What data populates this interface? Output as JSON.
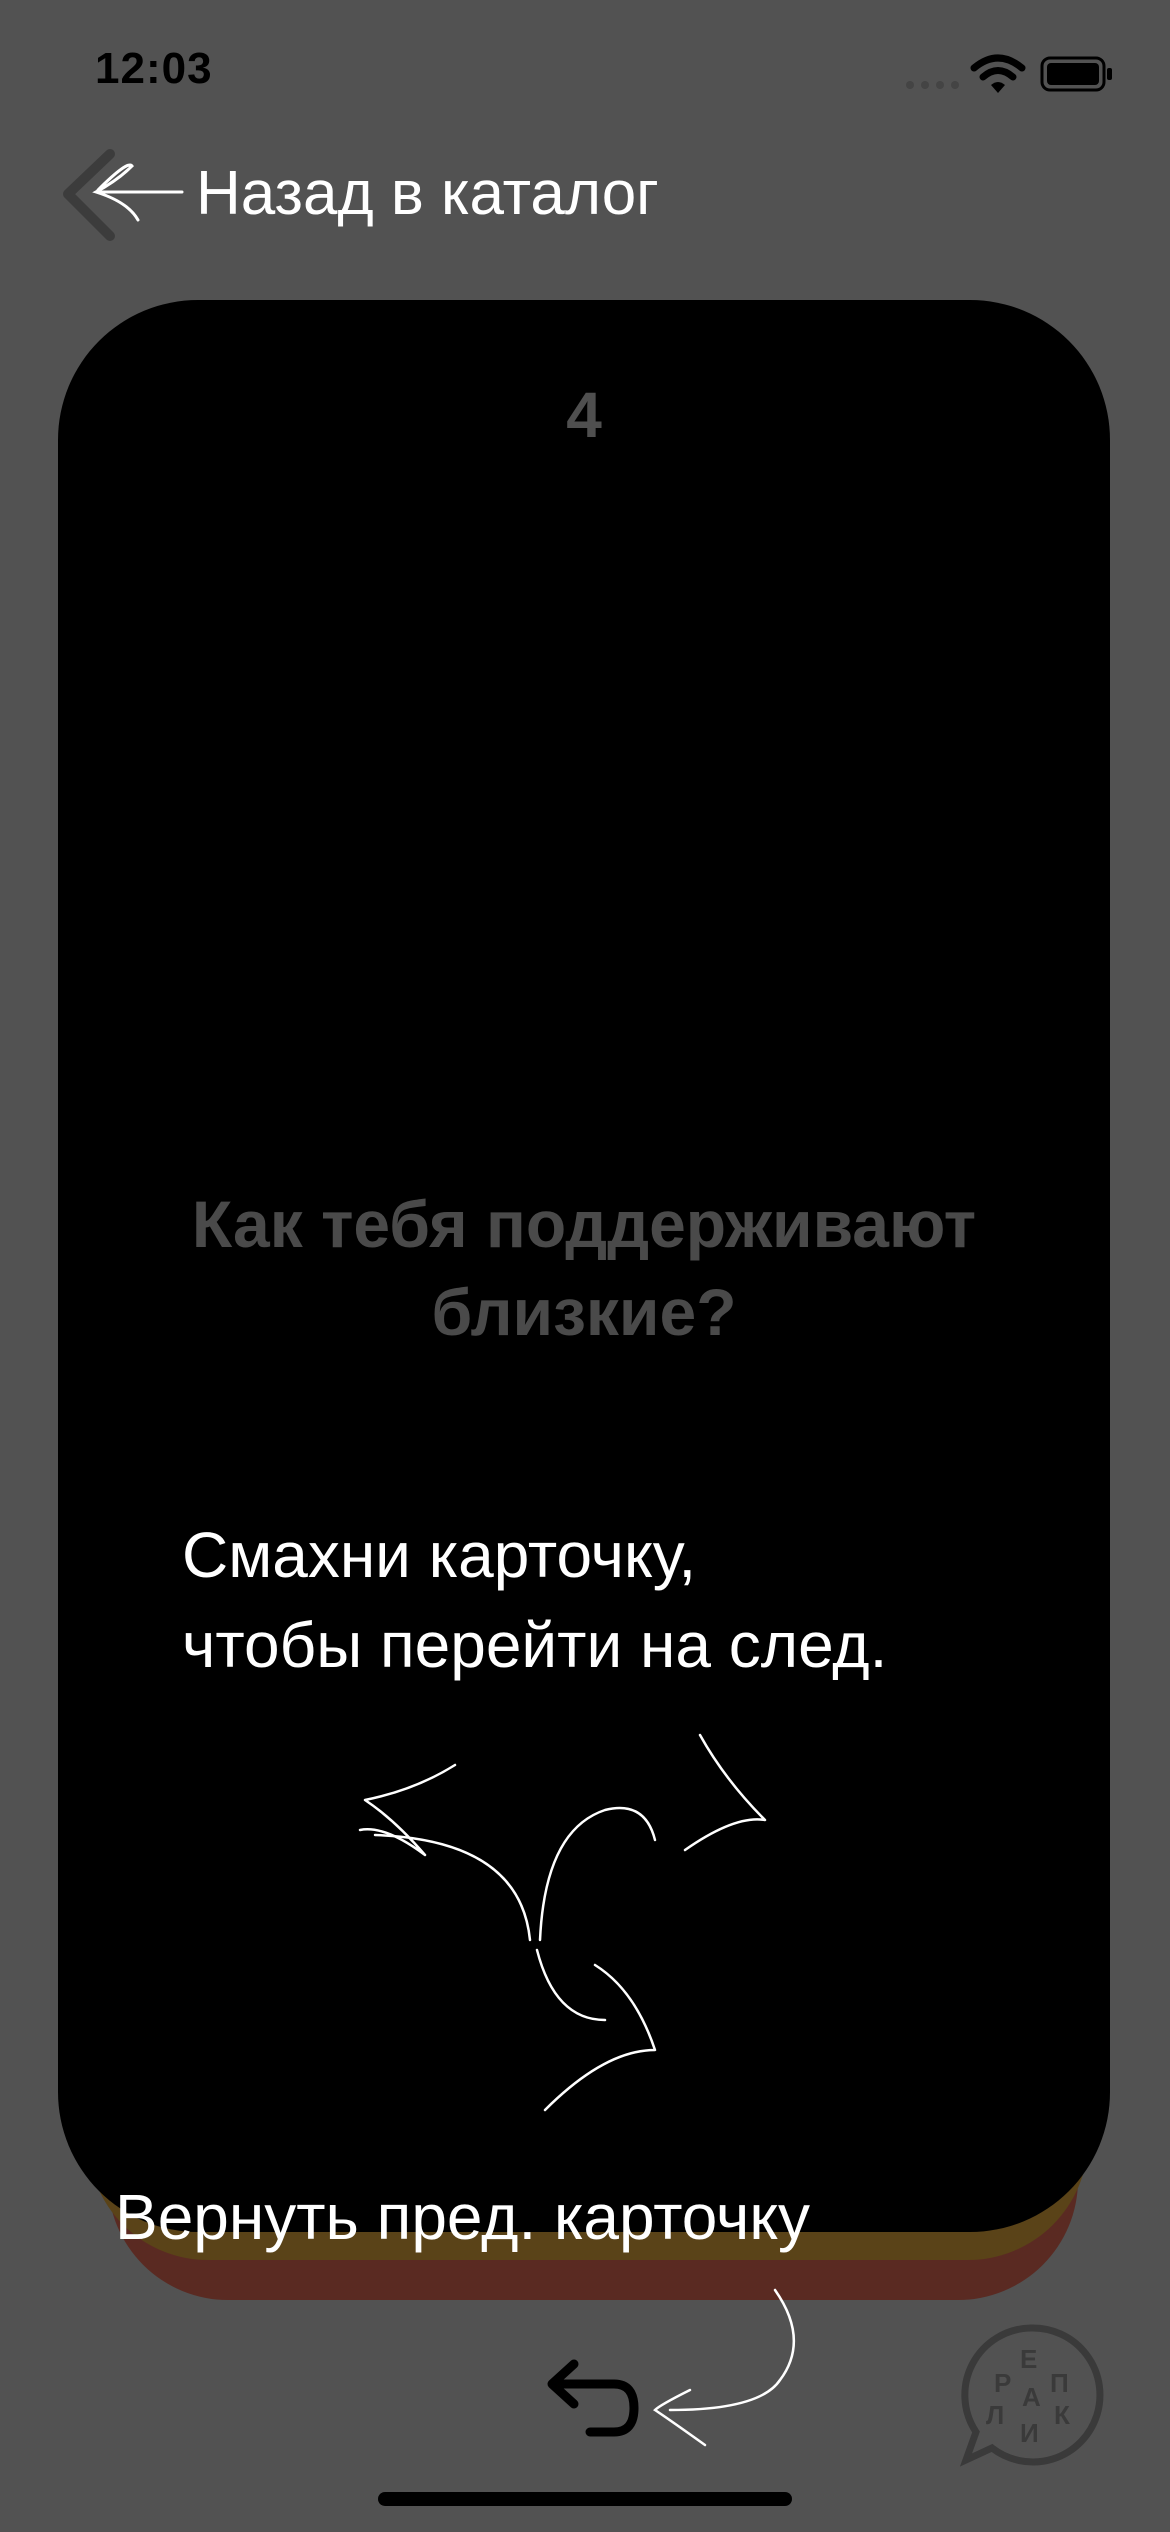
{
  "status_bar": {
    "time": "12:03"
  },
  "navigation": {
    "back_label": "Назад в каталог"
  },
  "card": {
    "number": "4",
    "question": "Как тебя поддерживают близкие?"
  },
  "swipe_hint": {
    "line1": "Смахни карточку,",
    "line2": "чтобы перейти на след."
  },
  "undo_hint": {
    "label": "Вернуть пред. карточку"
  },
  "logo": {
    "letters": [
      "Р",
      "Е",
      "П",
      "Л",
      "И",
      "К",
      "А"
    ]
  },
  "colors": {
    "background": "#525252",
    "card": "#000000",
    "card_text_dim": "#4a4a4a",
    "stack_yellow": "#5a4318",
    "stack_red": "#5a2a22"
  }
}
